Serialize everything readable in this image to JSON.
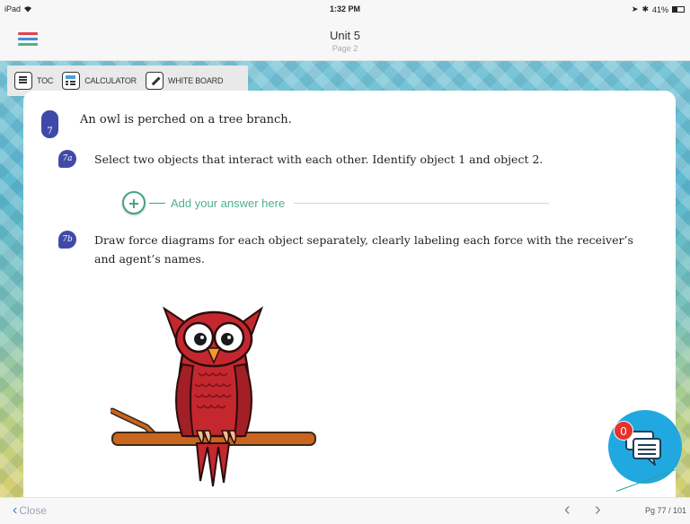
{
  "status_bar": {
    "device": "iPad",
    "time": "1:32 PM",
    "battery": "41%"
  },
  "header": {
    "title": "Unit 5",
    "subtitle": "Page 2"
  },
  "toolbar": {
    "toc_label": "TOC",
    "calculator_label": "CALCULATOR",
    "whiteboard_label": "WHITE BOARD"
  },
  "question": {
    "number": "7",
    "text": "An owl is perched on a tree branch.",
    "parts": [
      {
        "label": "7a",
        "text": "Select two objects that interact with each other. Identify object 1 and object 2."
      },
      {
        "label": "7b",
        "text": "Draw force diagrams for each object separately, clearly labeling each force with the receiver’s and agent’s names."
      }
    ],
    "answer_placeholder": "Add your answer here"
  },
  "chat": {
    "badge_count": "0"
  },
  "footer": {
    "close_label": "Close",
    "page_indicator": "Pg 77 / 101"
  },
  "colors": {
    "accent_blue": "#3f4aa8",
    "answer_green": "#46a287",
    "chat_blue": "#22a8e0",
    "badge_red": "#e5322d"
  }
}
